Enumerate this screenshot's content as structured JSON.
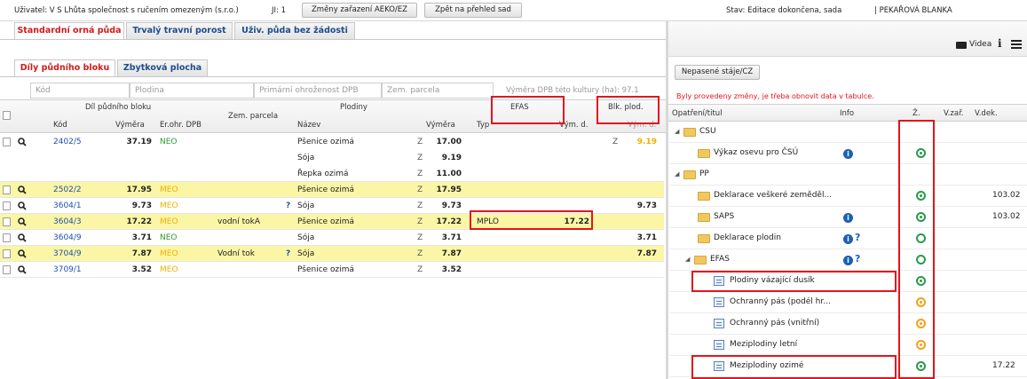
{
  "topbar": {
    "user": "Uživatel: V S Lhůta společnost s ručením omezeným (s.r.o.)",
    "ji": "JI: 1",
    "btn_changes": "Změny zařazení AEKO/EZ",
    "btn_back": "Zpět na přehled sad",
    "status": "Stav: Editace dokončena, sada",
    "person": "| PEKAŘOVÁ BLANKA"
  },
  "tabs_main": [
    "Standardní orná půda",
    "Trvalý travní porost",
    "Uživ. půda bez žádosti"
  ],
  "tabs_sub": [
    "Díly půdního bloku",
    "Zbytková plocha"
  ],
  "filters": {
    "kod": "Kód",
    "plodina": "Plodina",
    "ohrozenost": "Primární ohroženost DPB",
    "zem_parcela": "Zem. parcela",
    "vymera": "Výměra DPB této kultury (ha): 97.1"
  },
  "grid": {
    "group_dil": "Díl půdního bloku",
    "group_plodiny": "Plodiny",
    "group_efas": "EFAS",
    "group_blk": "Blk. plod.",
    "col_kod": "Kód",
    "col_vymera": "Výměra",
    "col_erohr": "Er.ohr. DPB",
    "col_zem": "Zem. parcela",
    "col_nazev": "Název",
    "col_vymera2": "Výměra",
    "col_typ": "Typ",
    "col_vymd": "Vým. d.",
    "col_vymd2": "Vým. d."
  },
  "rows": [
    {
      "kod": "2402/5",
      "vymera": "37.19",
      "er": "NEO",
      "zem": "",
      "plodiny": [
        {
          "q": "",
          "nazev": "Pšenice ozimá",
          "z": "Z",
          "vym": "17.00"
        },
        {
          "q": "",
          "nazev": "Sója",
          "z": "Z",
          "vym": "9.19"
        },
        {
          "q": "",
          "nazev": "Řepka ozimá",
          "z": "Z",
          "vym": "11.00"
        }
      ],
      "typ": "",
      "efas_vym": "",
      "blk_z": "Z",
      "blk": "9.19",
      "yellow": false
    },
    {
      "kod": "2502/2",
      "vymera": "17.95",
      "er": "MEO",
      "zem": "",
      "plodiny": [
        {
          "q": "",
          "nazev": "Pšenice ozimá",
          "z": "Z",
          "vym": "17.95"
        }
      ],
      "typ": "",
      "efas_vym": "",
      "blk_z": "",
      "blk": "",
      "yellow": true
    },
    {
      "kod": "3604/1",
      "vymera": "9.73",
      "er": "MEO",
      "zem": "",
      "plodiny": [
        {
          "q": "?",
          "nazev": "Sója",
          "z": "Z",
          "vym": "9.73"
        }
      ],
      "typ": "",
      "efas_vym": "",
      "blk_z": "",
      "blk": "9.73",
      "yellow": false
    },
    {
      "kod": "3604/3",
      "vymera": "17.22",
      "er": "MEO",
      "zem": "vodní tokA",
      "plodiny": [
        {
          "q": "",
          "nazev": "Pšenice ozimá",
          "z": "Z",
          "vym": "17.22"
        }
      ],
      "typ": "MPLO",
      "efas_vym": "17.22",
      "blk_z": "",
      "blk": "",
      "yellow": true
    },
    {
      "kod": "3604/9",
      "vymera": "3.71",
      "er": "NEO",
      "zem": "",
      "plodiny": [
        {
          "q": "",
          "nazev": "Sója",
          "z": "Z",
          "vym": "3.71"
        }
      ],
      "typ": "",
      "efas_vym": "",
      "blk_z": "",
      "blk": "3.71",
      "yellow": false
    },
    {
      "kod": "3704/9",
      "vymera": "7.87",
      "er": "MEO",
      "zem": "Vodní tok",
      "plodiny": [
        {
          "q": "?",
          "nazev": "Sója",
          "z": "Z",
          "vym": "7.87"
        }
      ],
      "typ": "",
      "efas_vym": "",
      "blk_z": "",
      "blk": "7.87",
      "yellow": true
    },
    {
      "kod": "3709/1",
      "vymera": "3.52",
      "er": "MEO",
      "zem": "",
      "plodiny": [
        {
          "q": "",
          "nazev": "Pšenice ozimá",
          "z": "Z",
          "vym": "3.52"
        }
      ],
      "typ": "",
      "efas_vym": "",
      "blk_z": "",
      "blk": "",
      "yellow": false
    }
  ],
  "right": {
    "videa": "Videa",
    "btn_staje": "Nepasené stáje/CZ",
    "warning": "Byly provedeny změny, je třeba obnovit data v tabulce.",
    "col_opatreni": "Opatření/titul",
    "col_info": "Info",
    "col_z": "Ž.",
    "col_vzar": "V.zař.",
    "col_vdek": "V.dek.",
    "tree": [
      {
        "label": "CSU",
        "level": 0,
        "kind": "folder",
        "expand": true,
        "info": false,
        "q": false,
        "circle": "",
        "vdek": ""
      },
      {
        "label": "Výkaz osevu pro ČSÚ",
        "level": 1,
        "kind": "folder",
        "expand": false,
        "info": true,
        "q": false,
        "circle": "green-dot",
        "vdek": ""
      },
      {
        "label": "PP",
        "level": 0,
        "kind": "folder",
        "expand": true,
        "info": false,
        "q": false,
        "circle": "",
        "vdek": ""
      },
      {
        "label": "Deklarace veškeré zeměděl...",
        "level": 1,
        "kind": "folder",
        "expand": false,
        "info": false,
        "q": false,
        "circle": "green-dot",
        "vdek": "103.02"
      },
      {
        "label": "SAPS",
        "level": 1,
        "kind": "folder",
        "expand": false,
        "info": true,
        "q": false,
        "circle": "green-dot",
        "vdek": "103.02"
      },
      {
        "label": "Deklarace plodin",
        "level": 1,
        "kind": "folder",
        "expand": false,
        "info": true,
        "q": true,
        "circle": "green",
        "vdek": ""
      },
      {
        "label": "EFAS",
        "level": 1,
        "kind": "folder",
        "expand": true,
        "info": true,
        "q": true,
        "circle": "green",
        "vdek": ""
      },
      {
        "label": "Plodiny vázající dusík",
        "level": 2,
        "kind": "doc",
        "expand": false,
        "info": false,
        "q": false,
        "circle": "green-dot",
        "vdek": ""
      },
      {
        "label": "Ochranný pás (podél hr...",
        "level": 2,
        "kind": "doc",
        "expand": false,
        "info": false,
        "q": false,
        "circle": "orange-dot",
        "vdek": ""
      },
      {
        "label": "Ochranný pás (vnitřní)",
        "level": 2,
        "kind": "doc",
        "expand": false,
        "info": false,
        "q": false,
        "circle": "orange-dot",
        "vdek": ""
      },
      {
        "label": "Meziplodiny letní",
        "level": 2,
        "kind": "doc",
        "expand": false,
        "info": false,
        "q": false,
        "circle": "orange-dot",
        "vdek": ""
      },
      {
        "label": "Meziplodiny ozimé",
        "level": 2,
        "kind": "doc",
        "expand": false,
        "info": false,
        "q": false,
        "circle": "green-dot",
        "vdek": "17.22"
      }
    ]
  },
  "colors": {
    "link": "#1f4fb0",
    "accent": "#d11a1a",
    "yellow": "#fbf6a6",
    "neo": "#2f9a2f",
    "meo": "#f0b000",
    "highlight": "#e2141e"
  }
}
